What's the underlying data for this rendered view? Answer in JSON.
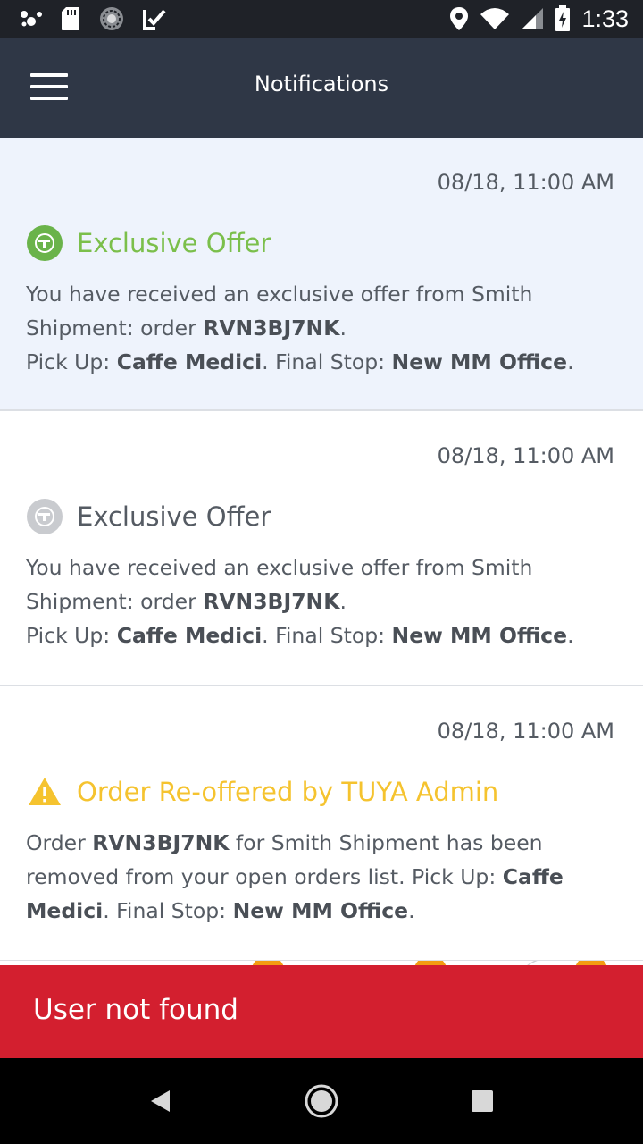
{
  "status_bar": {
    "time": "1:33",
    "icons": [
      "dots-icon",
      "sd-card-icon",
      "sync-circle-icon",
      "check-arrow-icon",
      "location-icon",
      "wifi-icon",
      "signal-icon",
      "battery-charging-icon"
    ]
  },
  "header": {
    "title": "Notifications",
    "menu_icon": "hamburger-menu-icon"
  },
  "notifications": [
    {
      "time": "08/18, 11:00 AM",
      "title": "Exclusive Offer",
      "icon": "offer-badge-icon",
      "state": "unread",
      "body_1": "You have received an exclusive offer from Smith Shipment: order ",
      "order": "RVN3BJ7NK",
      "body_2": ".",
      "pickup_label": "Pick Up: ",
      "pickup": "Caffe Medici",
      "final_label": ". Final Stop: ",
      "final_stop": "New MM Office",
      "end": "."
    },
    {
      "time": "08/18, 11:00 AM",
      "title": "Exclusive Offer",
      "icon": "offer-badge-icon",
      "state": "read",
      "body_1": "You have received an exclusive offer from Smith Shipment: order ",
      "order": "RVN3BJ7NK",
      "body_2": ".",
      "pickup_label": "Pick Up: ",
      "pickup": "Caffe Medici",
      "final_label": ". Final Stop: ",
      "final_stop": "New MM Office",
      "end": "."
    },
    {
      "time": "08/18, 11:00 AM",
      "title": "Order Re-offered by TUYA Admin",
      "icon": "warning-icon",
      "state": "read",
      "order_label": "Order ",
      "order": "RVN3BJ7NK",
      "body_1": " for Smith Shipment has been removed from  your open orders list. Pick Up: ",
      "pickup": "Caffe Medici",
      "final_label": ". Final Stop: ",
      "final_stop": "New MM Office",
      "end": "."
    }
  ],
  "toast": {
    "message": "User not found"
  },
  "nav_bar": {
    "icons": [
      "back-triangle-icon",
      "home-circle-icon",
      "recents-square-icon"
    ]
  },
  "colors": {
    "header_bg": "#2f3746",
    "status_bar_bg": "#1f2228",
    "unread_bg": "#eef3fc",
    "offer_green": "#7bbf4b",
    "warning_yellow": "#f5c32f",
    "toast_red": "#d31f2f",
    "text_gray": "#555b63"
  }
}
